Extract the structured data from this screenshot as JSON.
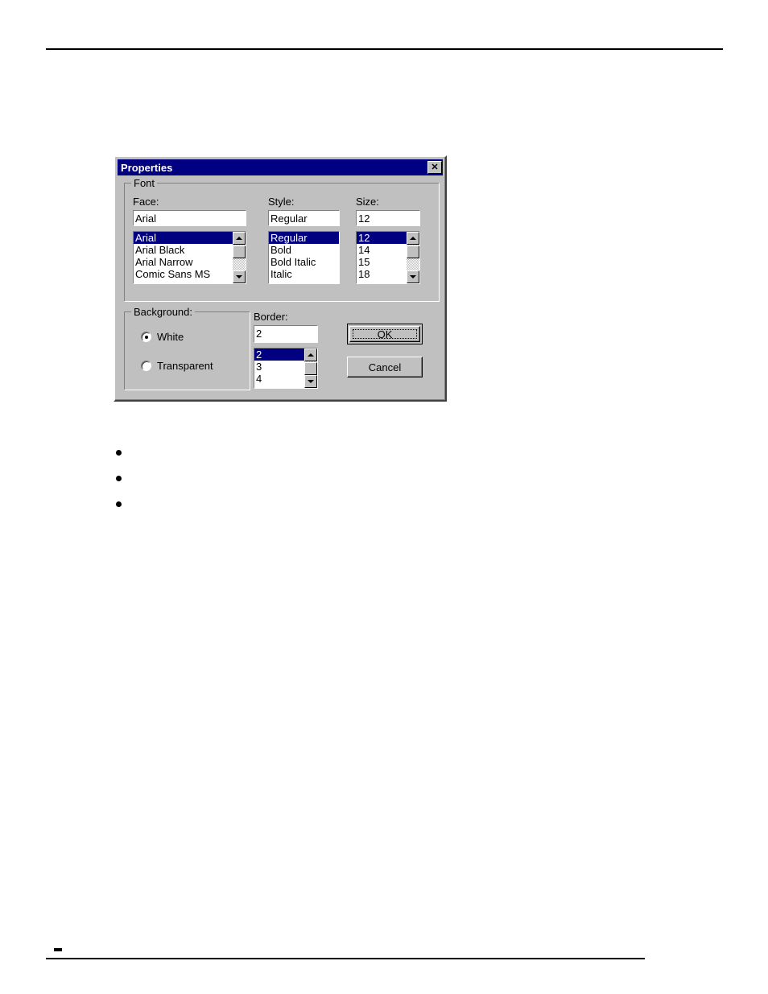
{
  "page": {
    "header_rule": true,
    "footer_rule": true,
    "bullets": [
      "",
      "",
      ""
    ]
  },
  "dialog": {
    "title": "Properties",
    "close_icon": "close-icon",
    "close_glyph": "✕",
    "colors": {
      "titlebar": "#000080",
      "face": "#c0c0c0",
      "selection": "#000080",
      "selection_text": "#ffffff",
      "field": "#ffffff"
    },
    "font_group": {
      "label": "Font",
      "face": {
        "label": "Face:",
        "value": "Arial",
        "options": [
          "Arial",
          "Arial Black",
          "Arial Narrow",
          "Comic Sans MS"
        ],
        "selected_index": 0,
        "has_scrollbar": true
      },
      "style": {
        "label": "Style:",
        "value": "Regular",
        "options": [
          "Regular",
          "Bold",
          "Bold Italic",
          "Italic"
        ],
        "selected_index": 0,
        "has_scrollbar": false
      },
      "size": {
        "label": "Size:",
        "value": "12",
        "options": [
          "12",
          "14",
          "15",
          "18"
        ],
        "selected_index": 0,
        "has_scrollbar": true
      }
    },
    "background_group": {
      "label": "Background:",
      "options": [
        {
          "label": "White",
          "checked": true
        },
        {
          "label": "Transparent",
          "checked": false
        }
      ]
    },
    "border_field": {
      "label": "Border:",
      "value": "2",
      "options": [
        "2",
        "3",
        "4"
      ],
      "selected_index": 0,
      "has_scrollbar": true
    },
    "buttons": {
      "ok": "OK",
      "cancel": "Cancel",
      "default": "ok"
    }
  }
}
